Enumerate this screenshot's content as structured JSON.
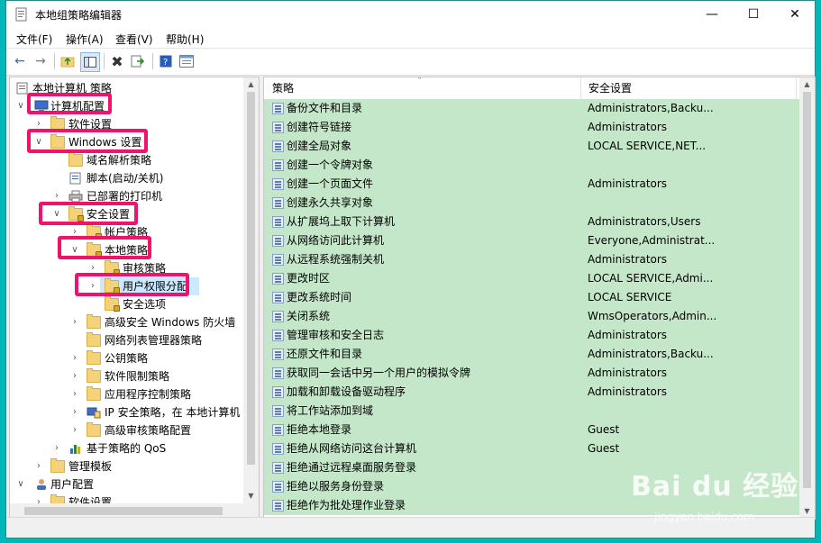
{
  "window": {
    "title": "本地组策略编辑器",
    "minimize": "—",
    "maximize": "☐",
    "close": "✕"
  },
  "menu": [
    "文件(F)",
    "操作(A)",
    "查看(V)",
    "帮助(H)"
  ],
  "tree": {
    "root": "本地计算机 策略",
    "items": [
      {
        "label": "计算机配置"
      },
      {
        "label": "软件设置"
      },
      {
        "label": "Windows 设置"
      },
      {
        "label": "域名解析策略"
      },
      {
        "label": "脚本(启动/关机)"
      },
      {
        "label": "已部署的打印机"
      },
      {
        "label": "安全设置"
      },
      {
        "label": "帐户策略"
      },
      {
        "label": "本地策略"
      },
      {
        "label": "审核策略"
      },
      {
        "label": "用户权限分配"
      },
      {
        "label": "安全选项"
      },
      {
        "label": "高级安全 Windows 防火墙"
      },
      {
        "label": "网络列表管理器策略"
      },
      {
        "label": "公钥策略"
      },
      {
        "label": "软件限制策略"
      },
      {
        "label": "应用程序控制策略"
      },
      {
        "label": "IP 安全策略，在 本地计算机"
      },
      {
        "label": "高级审核策略配置"
      },
      {
        "label": "基于策略的 QoS"
      },
      {
        "label": "管理模板"
      },
      {
        "label": "用户配置"
      },
      {
        "label": "软件设置"
      }
    ]
  },
  "columns": {
    "policy": "策略",
    "security": "安全设置"
  },
  "policies": [
    {
      "name": "备份文件和目录",
      "setting": "Administrators,Backu..."
    },
    {
      "name": "创建符号链接",
      "setting": "Administrators"
    },
    {
      "name": "创建全局对象",
      "setting": "LOCAL SERVICE,NET..."
    },
    {
      "name": "创建一个令牌对象",
      "setting": ""
    },
    {
      "name": "创建一个页面文件",
      "setting": "Administrators"
    },
    {
      "name": "创建永久共享对象",
      "setting": ""
    },
    {
      "name": "从扩展坞上取下计算机",
      "setting": "Administrators,Users"
    },
    {
      "name": "从网络访问此计算机",
      "setting": "Everyone,Administrat..."
    },
    {
      "name": "从远程系统强制关机",
      "setting": "Administrators"
    },
    {
      "name": "更改时区",
      "setting": "LOCAL SERVICE,Admi..."
    },
    {
      "name": "更改系统时间",
      "setting": "LOCAL SERVICE"
    },
    {
      "name": "关闭系统",
      "setting": "WmsOperators,Admin..."
    },
    {
      "name": "管理审核和安全日志",
      "setting": "Administrators"
    },
    {
      "name": "还原文件和目录",
      "setting": "Administrators,Backu..."
    },
    {
      "name": "获取同一会话中另一个用户的模拟令牌",
      "setting": "Administrators"
    },
    {
      "name": "加载和卸载设备驱动程序",
      "setting": "Administrators"
    },
    {
      "name": "将工作站添加到域",
      "setting": ""
    },
    {
      "name": "拒绝本地登录",
      "setting": "Guest"
    },
    {
      "name": "拒绝从网络访问这台计算机",
      "setting": "Guest"
    },
    {
      "name": "拒绝通过远程桌面服务登录",
      "setting": ""
    },
    {
      "name": "拒绝以服务身份登录",
      "setting": ""
    },
    {
      "name": "拒绝作为批处理作业登录",
      "setting": ""
    }
  ],
  "watermark": {
    "brand": "Bai du 经验",
    "url": "jingyan.baidu.com"
  },
  "colors": {
    "highlight": "#f0136c",
    "row_bg": "#c5e7c9",
    "desktop": "#00b7b7"
  }
}
